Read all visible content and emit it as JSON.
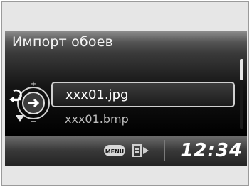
{
  "screen": {
    "title": "Импорт обоев",
    "items": [
      {
        "label": "xxx01.jpg",
        "selected": true
      },
      {
        "label": "xxx01.bmp",
        "selected": false
      }
    ],
    "menu_icon_label": "MENU",
    "clock": "12:34"
  },
  "colors": {
    "background": "#e6e6e6",
    "screen": "#000000",
    "text": "#ffffff",
    "selection_border": "#cfcfcf"
  },
  "icons": {
    "back": "back-arrow-icon",
    "knob": "rotary-knob-icon",
    "down": "down-arrow-icon",
    "menu": "menu-button-icon",
    "navigate": "navigate-icon"
  }
}
